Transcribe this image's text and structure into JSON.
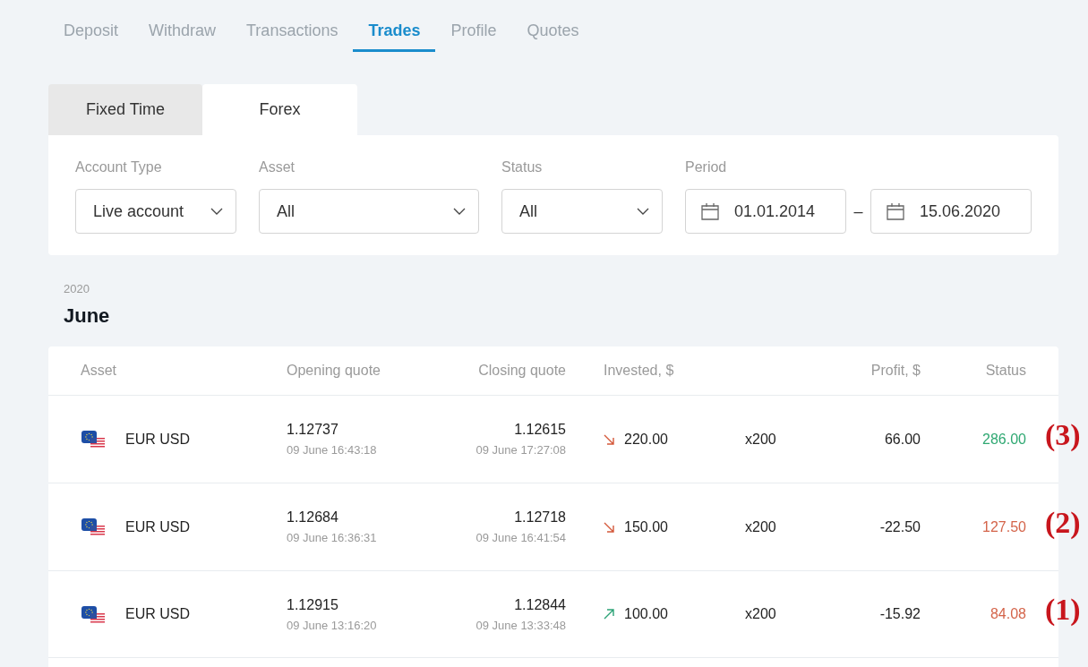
{
  "nav_tabs": [
    {
      "label": "Deposit",
      "selected": false
    },
    {
      "label": "Withdraw",
      "selected": false
    },
    {
      "label": "Transactions",
      "selected": false
    },
    {
      "label": "Trades",
      "selected": true
    },
    {
      "label": "Profile",
      "selected": false
    },
    {
      "label": "Quotes",
      "selected": false
    }
  ],
  "product_tabs": [
    {
      "label": "Fixed Time",
      "selected": false
    },
    {
      "label": "Forex",
      "selected": true
    }
  ],
  "filters": {
    "account_type": {
      "label": "Account Type",
      "value": "Live account"
    },
    "asset": {
      "label": "Asset",
      "value": "All"
    },
    "status": {
      "label": "Status",
      "value": "All"
    },
    "period": {
      "label": "Period",
      "from": "01.01.2014",
      "separator": "–",
      "to": "15.06.2020"
    }
  },
  "group": {
    "year": "2020",
    "month": "June"
  },
  "table": {
    "columns": [
      "Asset",
      "Opening quote",
      "Closing quote",
      "Invested, $",
      "Profit, $",
      "Status"
    ],
    "rows": [
      {
        "asset": "EUR USD",
        "open": {
          "quote": "1.12737",
          "time": "09 June 16:43:18"
        },
        "close": {
          "quote": "1.12615",
          "time": "09 June 17:27:08"
        },
        "rising": false,
        "invested": "220.00",
        "multiplier": "x200",
        "profit": "66.00",
        "status": {
          "value": "286.00",
          "color": "#2fa872"
        },
        "marker": "(3)"
      },
      {
        "asset": "EUR USD",
        "open": {
          "quote": "1.12684",
          "time": "09 June 16:36:31"
        },
        "close": {
          "quote": "1.12718",
          "time": "09 June 16:41:54"
        },
        "rising": false,
        "invested": "150.00",
        "multiplier": "x200",
        "profit": "-22.50",
        "status": {
          "value": "127.50",
          "color": "#d4644a"
        },
        "marker": "(2)"
      },
      {
        "asset": "EUR USD",
        "open": {
          "quote": "1.12915",
          "time": "09 June 13:16:20"
        },
        "close": {
          "quote": "1.12844",
          "time": "09 June 13:33:48"
        },
        "rising": true,
        "invested": "100.00",
        "multiplier": "x200",
        "profit": "-15.92",
        "status": {
          "value": "84.08",
          "color": "#d4644a"
        },
        "marker": "(1)"
      }
    ]
  }
}
